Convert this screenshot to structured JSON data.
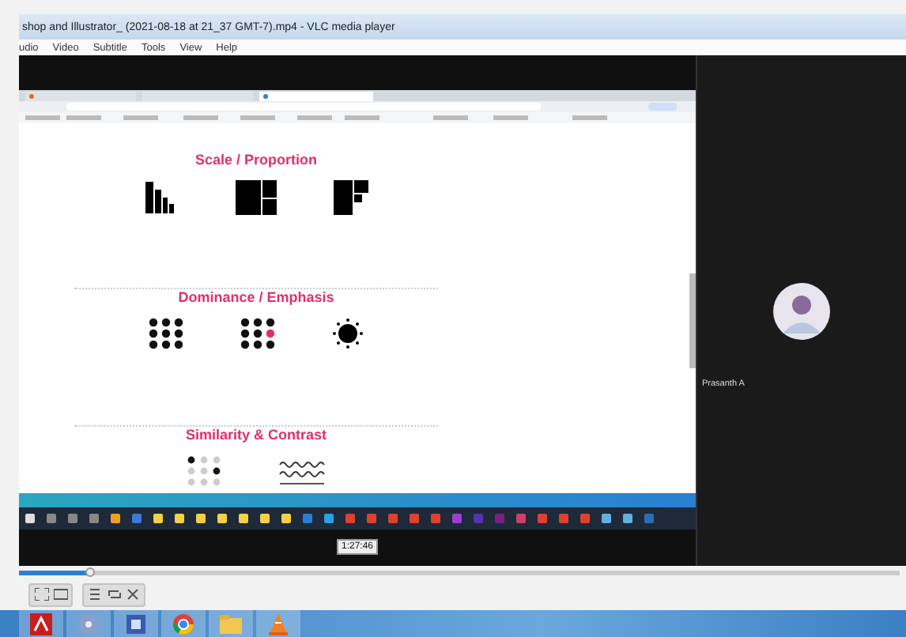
{
  "window": {
    "title": "shop and Illustrator_ (2021-08-18 at 21_37 GMT-7).mp4 - VLC media player"
  },
  "menu": [
    "udio",
    "Video",
    "Subtitle",
    "Tools",
    "View",
    "Help"
  ],
  "video": {
    "sections": [
      {
        "heading": "Scale / Proportion",
        "kind": "scale"
      },
      {
        "heading": "Dominance / Emphasis",
        "kind": "dominance"
      },
      {
        "heading": "Similarity & Contrast",
        "kind": "similarity"
      }
    ],
    "time_tooltip": "1:27:46",
    "participant": {
      "name": "Prasanth A"
    }
  },
  "seek": {
    "level": 0.08
  }
}
